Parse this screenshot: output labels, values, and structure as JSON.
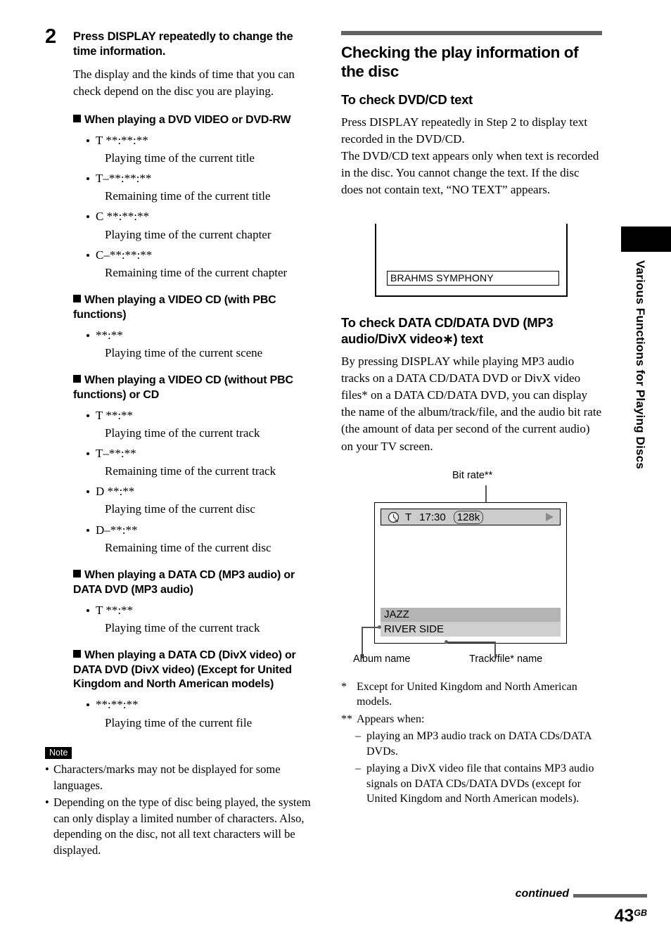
{
  "page": {
    "number": "43",
    "region_suffix": "GB",
    "continued_label": "continued",
    "side_tab_label": "Various Functions for Playing Discs"
  },
  "left_column": {
    "step": {
      "number": "2",
      "title": "Press DISPLAY repeatedly to change the time information.",
      "paragraph": "The display and the kinds of time that you can check depend on the disc you are playing."
    },
    "groups": [
      {
        "heading": "When playing a DVD VIDEO or DVD-RW",
        "items": [
          {
            "code": "T **:**:**",
            "desc": "Playing time of the current title"
          },
          {
            "code": "T–**:**:**",
            "desc": "Remaining time of the current title"
          },
          {
            "code": "C **:**:**",
            "desc": "Playing time of the current chapter"
          },
          {
            "code": "C–**:**:**",
            "desc": "Remaining time of the current chapter"
          }
        ]
      },
      {
        "heading": "When playing a VIDEO CD (with PBC functions)",
        "items": [
          {
            "code": "**:**",
            "desc": "Playing time of the current scene"
          }
        ]
      },
      {
        "heading": "When playing a VIDEO CD (without PBC functions) or CD",
        "items": [
          {
            "code": "T **:**",
            "desc": "Playing time of the current track"
          },
          {
            "code": "T–**:**",
            "desc": "Remaining time of the current track"
          },
          {
            "code": "D **:**",
            "desc": "Playing time of the current disc"
          },
          {
            "code": "D–**:**",
            "desc": "Remaining time of the current disc"
          }
        ]
      },
      {
        "heading": "When playing a DATA CD (MP3 audio) or DATA DVD (MP3 audio)",
        "items": [
          {
            "code": "T **:**",
            "desc": "Playing time of the current track"
          }
        ]
      },
      {
        "heading": "When playing a DATA CD (DivX video) or DATA DVD (DivX video) (Except for United Kingdom and North American models)",
        "items": [
          {
            "code": "**:**:**",
            "desc": "Playing time of the current file"
          }
        ]
      }
    ],
    "note": {
      "badge": "Note",
      "items": [
        "Characters/marks may not be displayed for some languages.",
        "Depending on the type of disc being played, the system can only display a limited number of characters. Also, depending on the disc, not all text characters will be displayed."
      ]
    }
  },
  "right_column": {
    "section_title": "Checking the play information of the disc",
    "sub1": {
      "title": "To check DVD/CD text",
      "paragraphs": [
        "Press DISPLAY repeatedly in Step 2 to display text recorded in the DVD/CD.",
        "The DVD/CD text appears only when text is recorded in the disc. You cannot change the text. If the disc does not contain text, “NO TEXT” appears."
      ]
    },
    "tv_screen_1": {
      "text_field": "BRAHMS  SYMPHONY"
    },
    "sub2": {
      "title": "To check DATA CD/DATA DVD (MP3 audio/DivX video∗) text",
      "paragraph": "By pressing DISPLAY while playing MP3 audio tracks on a DATA CD/DATA DVD or DivX video files* on a DATA CD/DATA DVD, you can display the name of the album/track/file, and the audio bit rate (the amount of data per second of the current audio) on your TV screen."
    },
    "tv_diagram": {
      "bitrate_callout": "Bit rate**",
      "status_mode": "T",
      "status_time": "17:30",
      "status_bitrate": "128k",
      "album_name": "JAZZ",
      "track_name": "RIVER SIDE",
      "album_callout": "Album name",
      "track_callout": "Track/file* name"
    },
    "footnotes": {
      "fn1_mark": "*",
      "fn1_text": "Except for United Kingdom and North American models.",
      "fn2_mark": "**",
      "fn2_text": "Appears when:",
      "fn2_sub": [
        "playing an MP3 audio track on DATA CDs/DATA DVDs.",
        "playing a DivX video file that contains MP3 audio signals on DATA CDs/DATA DVDs (except for United Kingdom and North American models)."
      ],
      "dash": "–"
    }
  }
}
